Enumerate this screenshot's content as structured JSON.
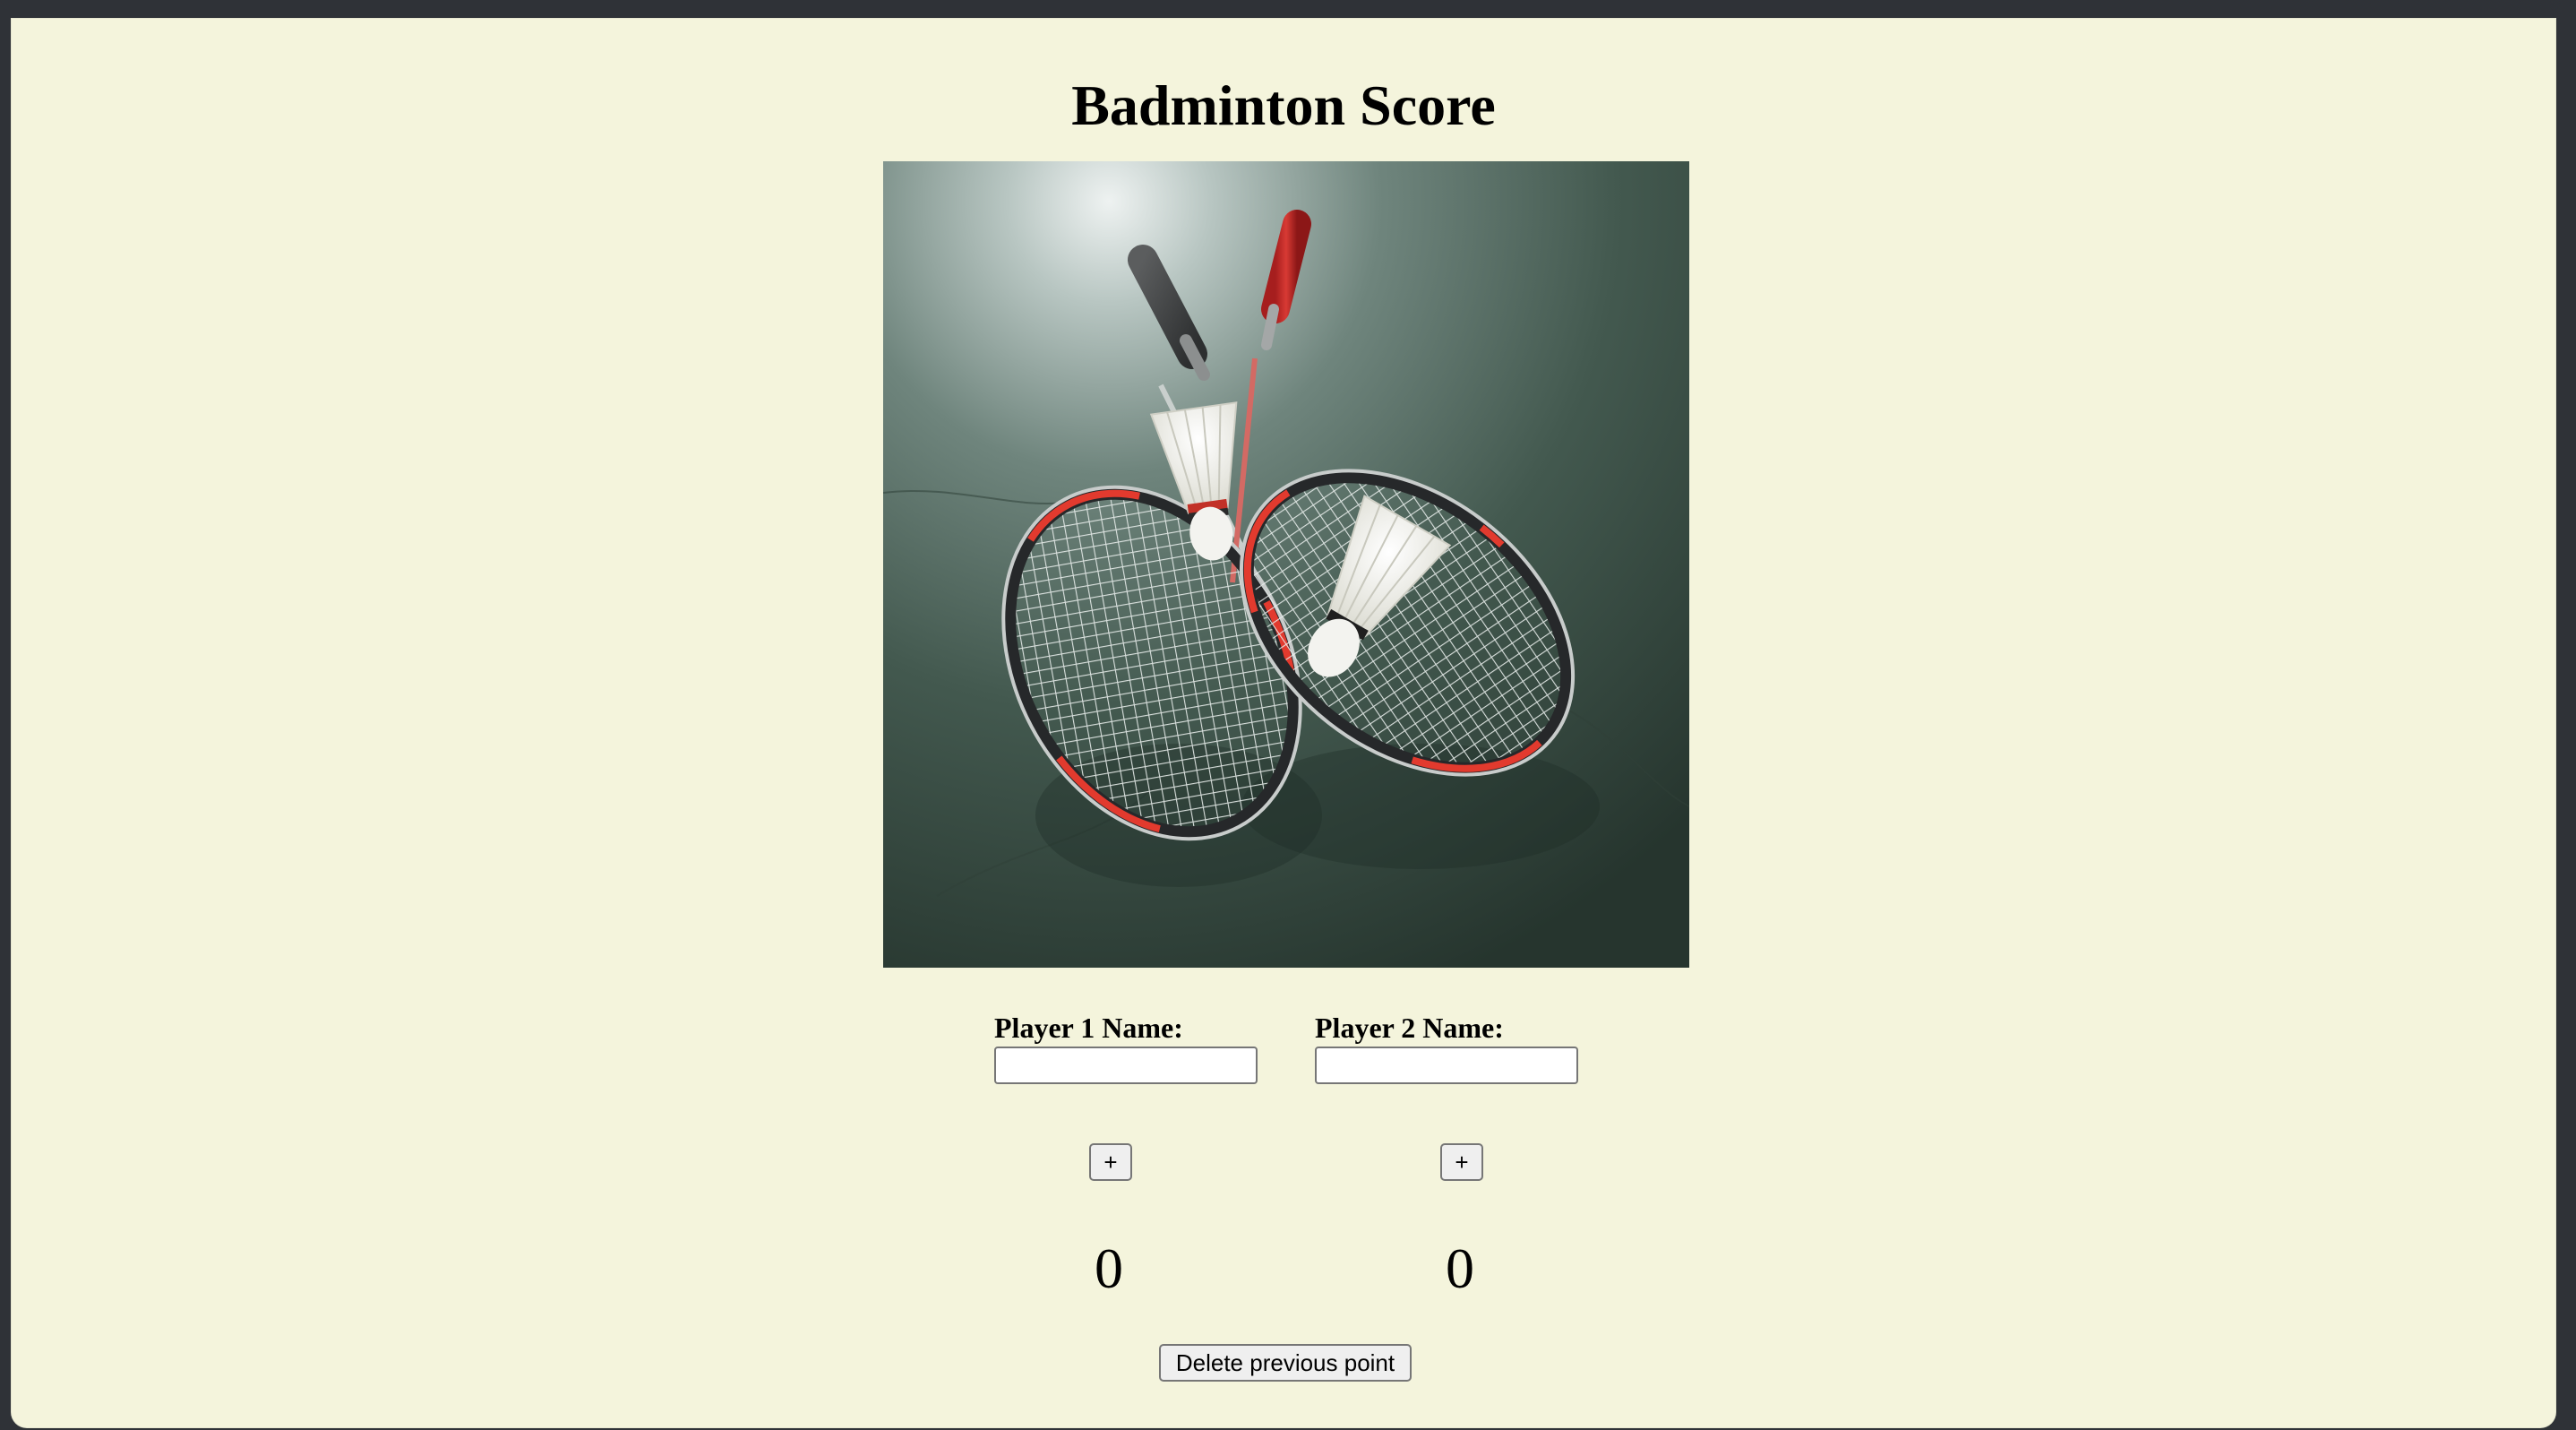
{
  "page": {
    "title": "Badminton Score",
    "background_color": "#f4f4dc"
  },
  "image": {
    "alt": "Two badminton rackets with shuttlecocks on a green court",
    "icon": "badminton-photo"
  },
  "players": [
    {
      "label": "Player 1 Name:",
      "name_value": "",
      "add_point_label": "+",
      "score": "0"
    },
    {
      "label": "Player 2 Name:",
      "name_value": "",
      "add_point_label": "+",
      "score": "0"
    }
  ],
  "controls": {
    "delete_label": "Delete previous point"
  }
}
